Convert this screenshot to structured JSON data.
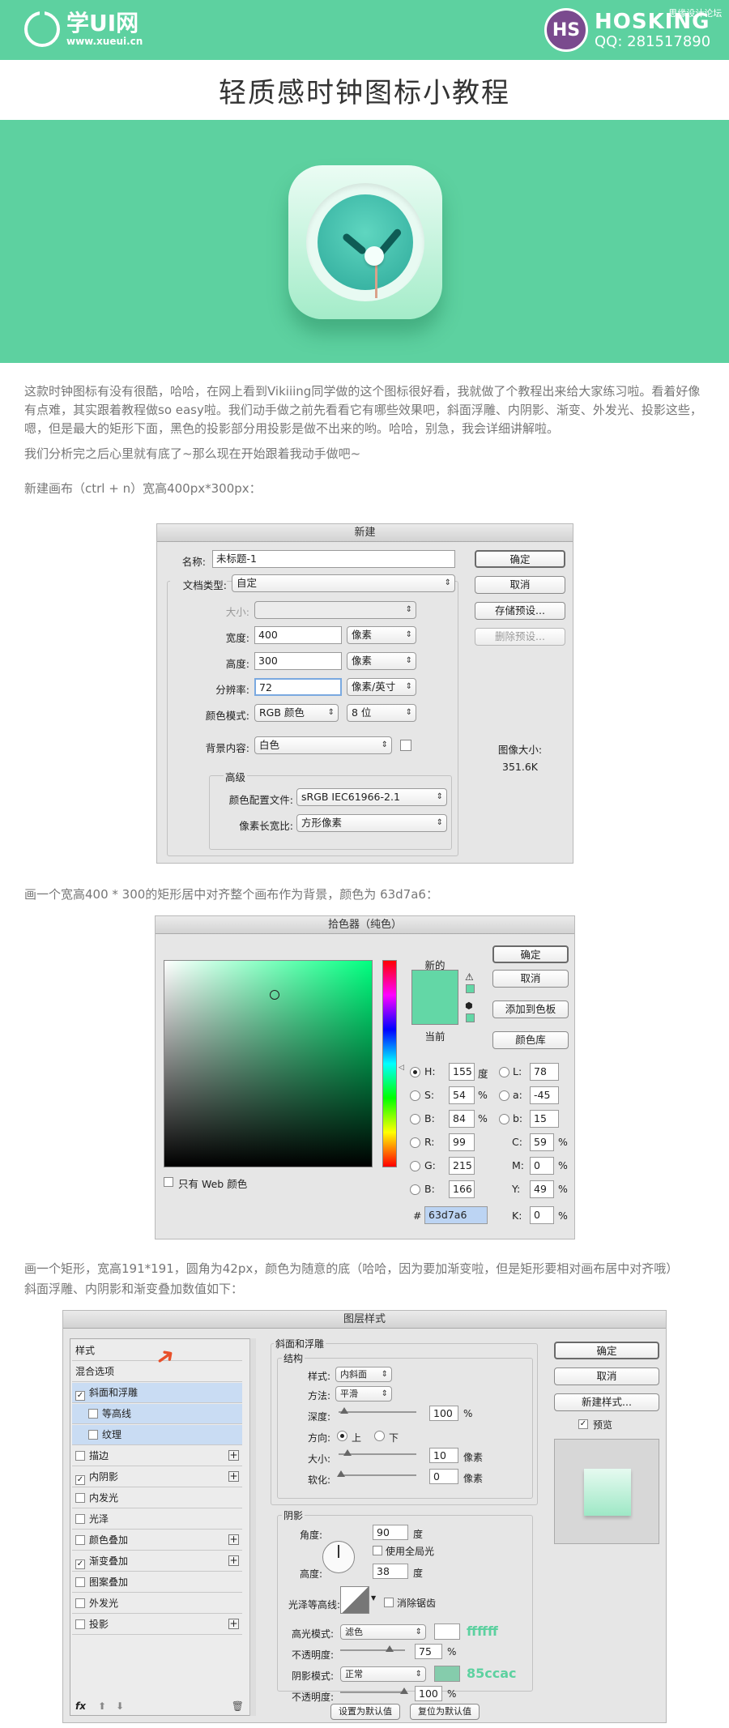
{
  "header": {
    "logo_name": "学UI网",
    "logo_url": "www.xueui.cn",
    "brand_badge": "HS",
    "brand_name": "HOSKING",
    "brand_qq": "QQ: 281517890",
    "watermark": "思缘设计论坛"
  },
  "page_title": "轻质感时钟图标小教程",
  "intro": {
    "p1": "这款时钟图标有没有很酷，哈哈，在网上看到Vikiiing同学做的这个图标很好看，我就做了个教程出来给大家练习啦。看着好像有点难，其实跟着教程做so easy啦。我们动手做之前先看看它有哪些效果吧，斜面浮雕、内阴影、渐变、外发光、投影这些，嗯，但是最大的矩形下面，黑色的投影部分用投影是做不出来的哟。哈哈，别急，我会详细讲解啦。",
    "p2": "我们分析完之后心里就有底了~那么现在开始跟着我动手做吧~"
  },
  "step1": "新建画布（ctrl + n）宽高400px*300px：",
  "new_dialog": {
    "title": "新建",
    "name_label": "名称:",
    "name_value": "未标题-1",
    "preset_label": "文档类型:",
    "preset_value": "自定",
    "size_label": "大小:",
    "width_label": "宽度:",
    "width_value": "400",
    "width_unit": "像素",
    "height_label": "高度:",
    "height_value": "300",
    "height_unit": "像素",
    "res_label": "分辨率:",
    "res_value": "72",
    "res_unit": "像素/英寸",
    "mode_label": "颜色模式:",
    "mode_value": "RGB 颜色",
    "depth_value": "8 位",
    "bg_label": "背景内容:",
    "bg_value": "白色",
    "advanced": "高级",
    "profile_label": "颜色配置文件:",
    "profile_value": "sRGB IEC61966-2.1",
    "aspect_label": "像素长宽比:",
    "aspect_value": "方形像素",
    "ok": "确定",
    "cancel": "取消",
    "save_preset": "存储预设...",
    "delete_preset": "删除预设...",
    "img_size_label": "图像大小:",
    "img_size_value": "351.6K"
  },
  "step2": "画一个宽高400 * 300的矩形居中对齐整个画布作为背景，颜色为 63d7a6：",
  "picker": {
    "title": "拾色器（纯色）",
    "new_label": "新的",
    "current_label": "当前",
    "new_color": "#63d7a6",
    "ok": "确定",
    "cancel": "取消",
    "add_swatch": "添加到色板",
    "library": "颜色库",
    "web_only": "只有 Web 颜色",
    "H": "155",
    "H_unit": "度",
    "S": "54",
    "B": "84",
    "pct": "%",
    "R": "99",
    "G": "215",
    "Bv": "166",
    "L": "78",
    "a": "-45",
    "b": "15",
    "C": "59",
    "M": "0",
    "Y": "49",
    "K": "0",
    "hex_label": "#",
    "hex": "63d7a6",
    "lbl_H": "H:",
    "lbl_S": "S:",
    "lbl_B": "B:",
    "lbl_R": "R:",
    "lbl_G": "G:",
    "lbl_Bb": "B:",
    "lbl_L": "L:",
    "lbl_a": "a:",
    "lbl_b": "b:",
    "lbl_C": "C:",
    "lbl_M": "M:",
    "lbl_Y": "Y:",
    "lbl_K": "K:"
  },
  "step3": {
    "line1": "画一个矩形，宽高191*191，圆角为42px，颜色为随意的底（哈哈，因为要加渐变啦，但是矩形要相对画布居中对齐哦）",
    "line2": "斜面浮雕、内阴影和渐变叠加数值如下："
  },
  "layer_style": {
    "title": "图层样式",
    "items": [
      {
        "label": "样式",
        "check": false,
        "has_cb": false,
        "plus": false,
        "sel": false
      },
      {
        "label": "混合选项",
        "check": false,
        "has_cb": false,
        "plus": false,
        "sel": false
      },
      {
        "label": "斜面和浮雕",
        "check": true,
        "has_cb": true,
        "plus": false,
        "sel": true
      },
      {
        "label": "等高线",
        "check": false,
        "has_cb": true,
        "plus": false,
        "sel": true,
        "indent": true
      },
      {
        "label": "纹理",
        "check": false,
        "has_cb": true,
        "plus": false,
        "sel": true,
        "indent": true
      },
      {
        "label": "描边",
        "check": false,
        "has_cb": true,
        "plus": true,
        "sel": false
      },
      {
        "label": "内阴影",
        "check": true,
        "has_cb": true,
        "plus": true,
        "sel": false
      },
      {
        "label": "内发光",
        "check": false,
        "has_cb": true,
        "plus": false,
        "sel": false
      },
      {
        "label": "光泽",
        "check": false,
        "has_cb": true,
        "plus": false,
        "sel": false
      },
      {
        "label": "颜色叠加",
        "check": false,
        "has_cb": true,
        "plus": true,
        "sel": false
      },
      {
        "label": "渐变叠加",
        "check": true,
        "has_cb": true,
        "plus": true,
        "sel": false
      },
      {
        "label": "图案叠加",
        "check": false,
        "has_cb": true,
        "plus": false,
        "sel": false
      },
      {
        "label": "外发光",
        "check": false,
        "has_cb": true,
        "plus": false,
        "sel": false
      },
      {
        "label": "投影",
        "check": false,
        "has_cb": true,
        "plus": true,
        "sel": false
      }
    ],
    "section": "斜面和浮雕",
    "structure": "结构",
    "style_label": "样式:",
    "style_value": "内斜面",
    "method_label": "方法:",
    "method_value": "平滑",
    "depth_label": "深度:",
    "depth_value": "100",
    "depth_unit": "%",
    "direction_label": "方向:",
    "dir_up": "上",
    "dir_down": "下",
    "size_label": "大小:",
    "size_value": "10",
    "size_unit": "像素",
    "soften_label": "软化:",
    "soften_value": "0",
    "soften_unit": "像素",
    "shading": "阴影",
    "angle_label": "角度:",
    "angle_value": "90",
    "angle_unit": "度",
    "global_light": "使用全局光",
    "altitude_label": "高度:",
    "altitude_value": "38",
    "altitude_unit": "度",
    "gloss_label": "光泽等高线:",
    "antialias": "消除锯齿",
    "hl_mode_label": "高光模式:",
    "hl_mode_value": "滤色",
    "hl_color": "ffffff",
    "hl_opacity_label": "不透明度:",
    "hl_opacity_value": "75",
    "sh_mode_label": "阴影模式:",
    "sh_mode_value": "正常",
    "sh_color": "85ccac",
    "sh_color_hex": "#85ccac",
    "sh_opacity_label": "不透明度:",
    "sh_opacity_value": "100",
    "pct": "%",
    "set_default": "设置为默认值",
    "reset_default": "复位为默认值",
    "ok": "确定",
    "cancel": "取消",
    "new_style": "新建样式...",
    "preview": "预览",
    "fx": "fx"
  },
  "colors": {
    "brand": "#5dd1a0",
    "accent_note": "#5dd1a0"
  }
}
